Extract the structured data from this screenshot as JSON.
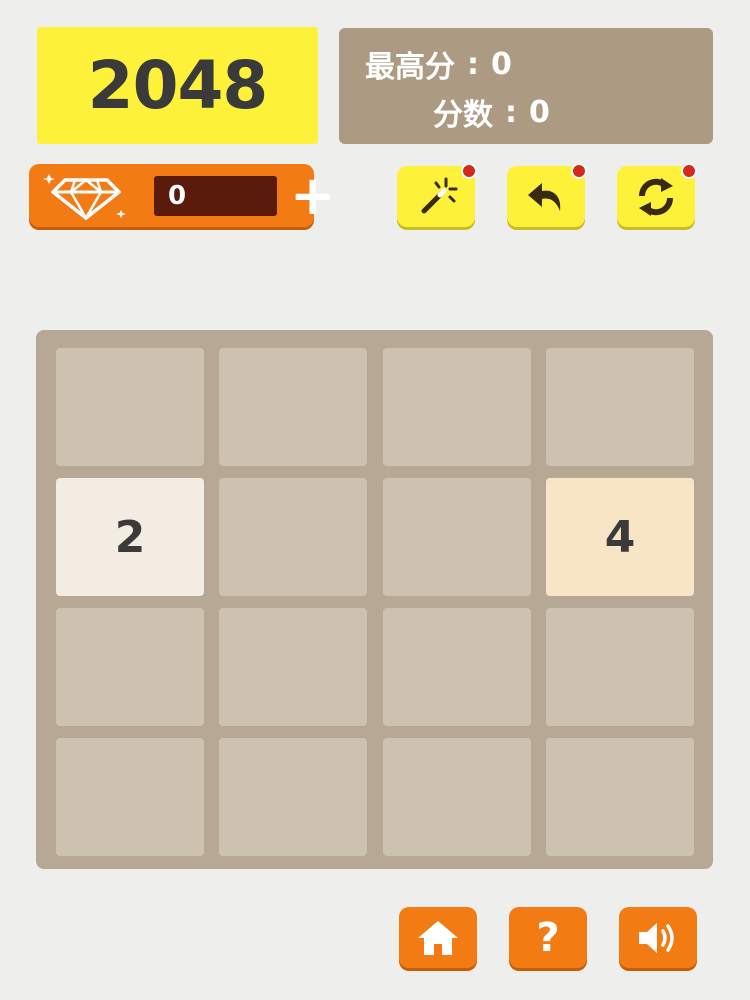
{
  "logo": {
    "text": "2048"
  },
  "scores": {
    "best_label": "最高分",
    "best_value": "0",
    "current_label": "分数",
    "current_value": "0",
    "separator": ":"
  },
  "gems": {
    "count": "0",
    "plus": "+"
  },
  "tools": [
    {
      "name": "magic-wand",
      "icon": "magic-wand-icon",
      "badge": true
    },
    {
      "name": "undo",
      "icon": "undo-arrow-icon",
      "badge": true
    },
    {
      "name": "restart",
      "icon": "refresh-icon",
      "badge": true
    }
  ],
  "board": {
    "rows": 4,
    "cols": 4,
    "cells": [
      [
        "",
        "",
        "",
        ""
      ],
      [
        "2",
        "",
        "",
        "4"
      ],
      [
        "",
        "",
        "",
        ""
      ],
      [
        "",
        "",
        "",
        ""
      ]
    ]
  },
  "nav": [
    {
      "name": "home",
      "icon": "home-icon"
    },
    {
      "name": "help",
      "icon": "question-icon",
      "label": "?"
    },
    {
      "name": "sound",
      "icon": "speaker-icon"
    }
  ],
  "colors": {
    "background": "#eeeeec",
    "logo": "#fdf13a",
    "scores_panel": "#ac9a83",
    "orange": "#f37b14",
    "board": "#b6a895",
    "empty_cell": "#cdc1b0",
    "tile_2": "#f3ece3",
    "tile_4": "#f8e5c6",
    "badge": "#d42a1e"
  }
}
